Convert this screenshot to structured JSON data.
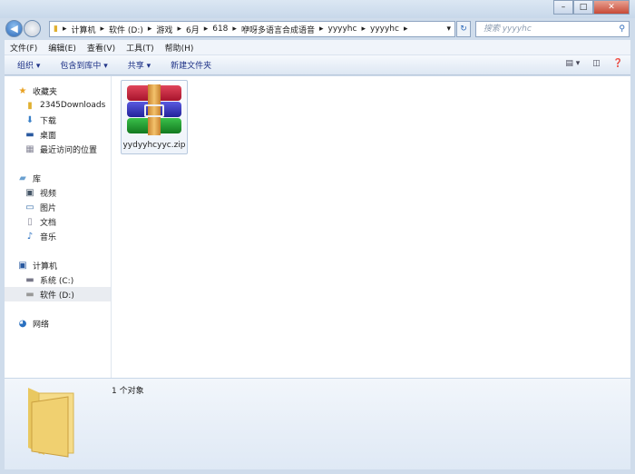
{
  "window": {
    "buttons": [
      "minimize",
      "maximize",
      "close"
    ]
  },
  "address": {
    "segments": [
      "计算机",
      "软件 (D:)",
      "游戏",
      "6月",
      "618",
      "咿呀多语言合成语音",
      "yyyyhc",
      "yyyyhc"
    ],
    "search_placeholder": "搜索 yyyyhc"
  },
  "menu": [
    "文件(F)",
    "编辑(E)",
    "查看(V)",
    "工具(T)",
    "帮助(H)"
  ],
  "toolbar": {
    "organize": "组织 ▾",
    "include": "包含到库中 ▾",
    "share": "共享 ▾",
    "new_folder": "新建文件夹"
  },
  "nav": {
    "favorites": {
      "label": "收藏夹",
      "items": [
        "2345Downloads",
        "下载",
        "桌面",
        "最近访问的位置"
      ]
    },
    "libraries": {
      "label": "库",
      "items": [
        "视频",
        "图片",
        "文档",
        "音乐"
      ]
    },
    "computer": {
      "label": "计算机",
      "items": [
        "系统 (C:)",
        "软件 (D:)"
      ]
    },
    "network": {
      "label": "网络"
    }
  },
  "files": [
    {
      "name": "yydyyhcyyc.zip"
    }
  ],
  "details": {
    "count": "1 个对象"
  }
}
